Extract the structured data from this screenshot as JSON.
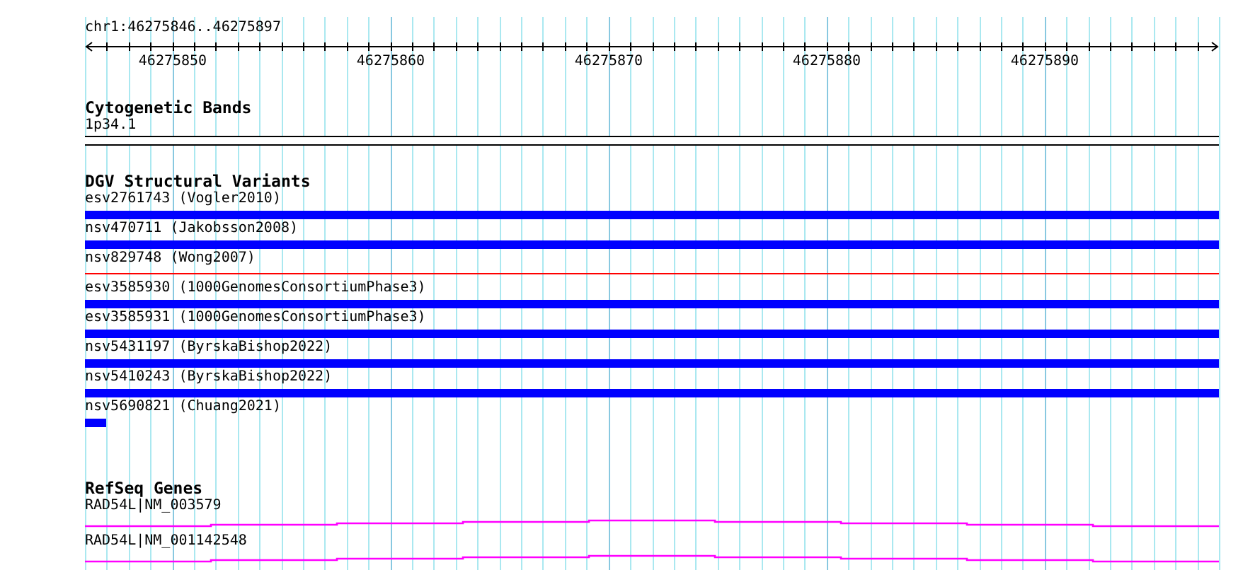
{
  "ruler": {
    "label": "chr1:46275846..46275897",
    "ticks": [
      "46275850",
      "46275860",
      "46275870",
      "46275880",
      "46275890"
    ]
  },
  "tracks": [
    {
      "kind": "cytoband",
      "title": "Cytogenetic Bands",
      "features": [
        {
          "label": "1p34.1"
        }
      ]
    },
    {
      "kind": "variants",
      "title": "DGV Structural Variants",
      "features": [
        {
          "label": "esv2761743 (Vogler2010)",
          "color": "#0000ff",
          "kind": "bar",
          "spans_view": true
        },
        {
          "label": "nsv470711 (Jakobsson2008)",
          "color": "#0000ff",
          "kind": "bar",
          "spans_view": true
        },
        {
          "label": "nsv829748 (Wong2007)",
          "color": "#ff0000",
          "kind": "line",
          "spans_view": true
        },
        {
          "label": "esv3585930 (1000GenomesConsortiumPhase3)",
          "color": "#0000ff",
          "kind": "bar",
          "spans_view": true
        },
        {
          "label": "esv3585931 (1000GenomesConsortiumPhase3)",
          "color": "#0000ff",
          "kind": "bar",
          "spans_view": true
        },
        {
          "label": "nsv5431197 (ByrskaBishop2022)",
          "color": "#0000ff",
          "kind": "bar",
          "spans_view": true
        },
        {
          "label": "nsv5410243 (ByrskaBishop2022)",
          "color": "#0000ff",
          "kind": "bar",
          "spans_view": true
        },
        {
          "label": "nsv5690821 (Chuang2021)",
          "color": "#0000ff",
          "kind": "bar",
          "spans_view": false
        }
      ]
    },
    {
      "kind": "genes",
      "title": "RefSeq Genes",
      "features": [
        {
          "label": "RAD54L|NM_003579"
        },
        {
          "label": "RAD54L|NM_001142548"
        }
      ]
    }
  ]
}
